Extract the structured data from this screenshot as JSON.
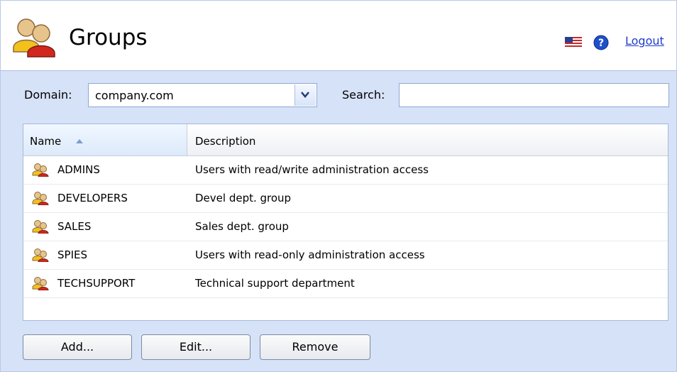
{
  "header": {
    "title": "Groups",
    "logout_label": "Logout"
  },
  "toolbar": {
    "domain_label": "Domain:",
    "domain_value": "company.com",
    "search_label": "Search:",
    "search_value": ""
  },
  "table": {
    "columns": [
      "Name",
      "Description"
    ],
    "sort_column": "Name",
    "rows": [
      {
        "name": "ADMINS",
        "description": "Users with read/write administration access"
      },
      {
        "name": "DEVELOPERS",
        "description": "Devel dept. group"
      },
      {
        "name": "SALES",
        "description": "Sales dept. group"
      },
      {
        "name": "SPIES",
        "description": "Users with read-only administration access"
      },
      {
        "name": "TECHSUPPORT",
        "description": "Technical support department"
      }
    ]
  },
  "buttons": {
    "add": "Add...",
    "edit": "Edit...",
    "remove": "Remove"
  },
  "icons": {
    "logo": "users-group-icon",
    "flag": "us-flag-icon",
    "help": "help-icon",
    "dropdown": "chevron-down-icon",
    "sort": "sort-ascending-icon",
    "row": "group-icon"
  },
  "colors": {
    "panel": "#d6e2f7",
    "link": "#1f3dcc",
    "help": "#1e50c8"
  }
}
